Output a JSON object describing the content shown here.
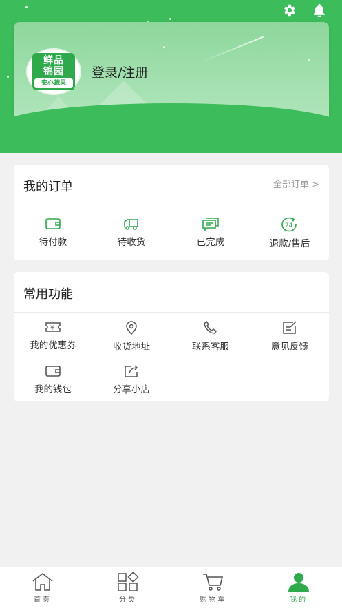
{
  "header": {
    "settings_icon": "gear-icon",
    "bell_icon": "bell-icon",
    "logo": {
      "line1": "鲜品",
      "line2": "锦园",
      "sub": "安心蔬果"
    },
    "login_label": "登录/注册"
  },
  "orders": {
    "title": "我的订单",
    "more_label": "全部订单 >",
    "items": [
      {
        "label": "待付款",
        "icon": "wallet-icon"
      },
      {
        "label": "待收货",
        "icon": "truck-icon"
      },
      {
        "label": "已完成",
        "icon": "message-stack-icon"
      },
      {
        "label": "退款/售后",
        "icon": "24h-service-icon"
      }
    ]
  },
  "functions": {
    "title": "常用功能",
    "items": [
      {
        "label": "我的优惠券",
        "icon": "coupon-icon"
      },
      {
        "label": "收货地址",
        "icon": "location-pin-icon"
      },
      {
        "label": "联系客服",
        "icon": "phone-icon"
      },
      {
        "label": "意见反馈",
        "icon": "feedback-icon"
      },
      {
        "label": "我的钱包",
        "icon": "wallet-icon"
      },
      {
        "label": "分享小店",
        "icon": "share-icon"
      }
    ]
  },
  "tabbar": {
    "items": [
      {
        "label": "首页",
        "icon": "home-icon"
      },
      {
        "label": "分类",
        "icon": "category-icon"
      },
      {
        "label": "购物车",
        "icon": "cart-icon"
      },
      {
        "label": "我的",
        "icon": "user-icon"
      }
    ],
    "active_index": 3,
    "active_color": "#2ea94c"
  },
  "colors": {
    "brand_green": "#3cbc5a",
    "icon_green": "#2ea94c",
    "background": "#f1f1f1"
  }
}
